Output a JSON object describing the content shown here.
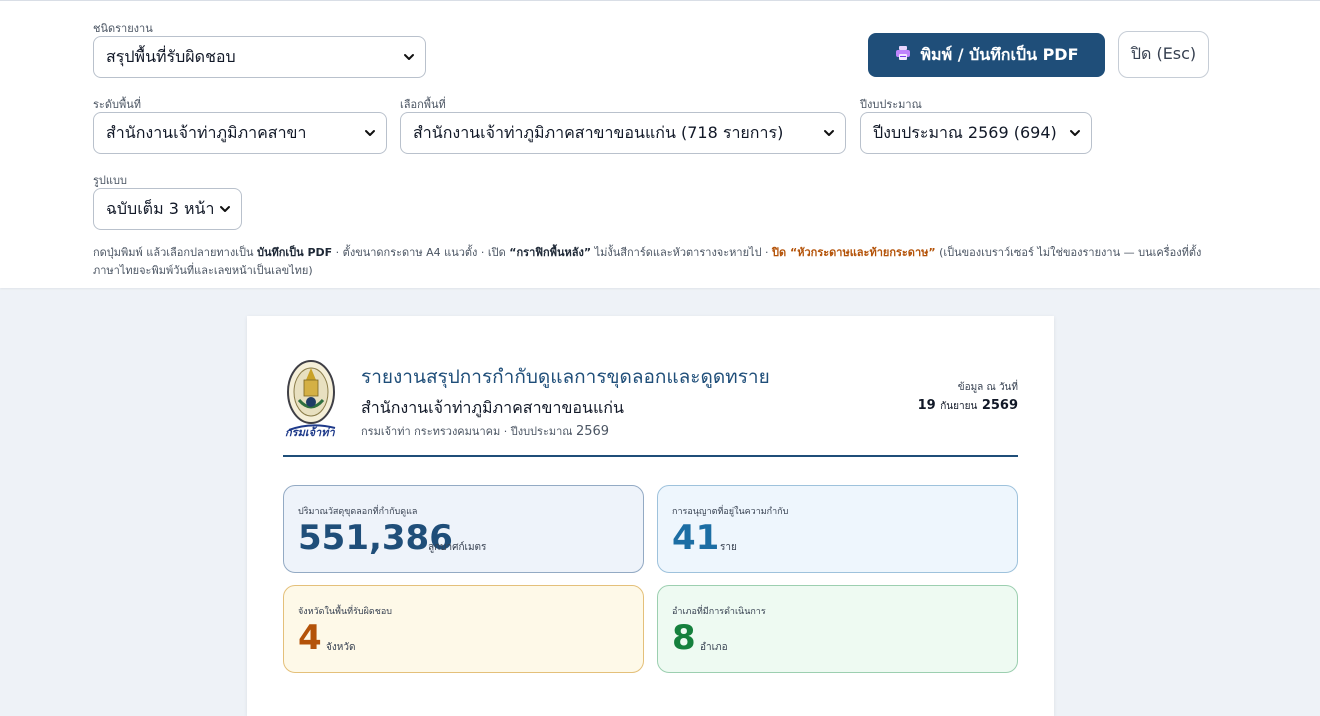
{
  "controls": {
    "report_type": {
      "label": "ชนิดรายงาน",
      "value": "สรุปพื้นที่รับผิดชอบ"
    },
    "area_level": {
      "label": "ระดับพื้นที่",
      "value": "สำนักงานเจ้าท่าภูมิภาคสาขา"
    },
    "area": {
      "label": "เลือกพื้นที่",
      "value": "สำนักงานเจ้าท่าภูมิภาคสาขาขอนแก่น (718 รายการ)"
    },
    "fiscal_year": {
      "label": "ปีงบประมาณ",
      "value": "ปีงบประมาณ 2569 (694)"
    },
    "format": {
      "label": "รูปแบบ",
      "value": "ฉบับเต็ม 3 หน้า"
    },
    "print_button": "พิมพ์ / บันทึกเป็น PDF",
    "close_button": "ปิด (Esc)"
  },
  "hint": {
    "part1": "กดปุ่มพิมพ์ แล้วเลือกปลายทางเป็น ",
    "save_pdf": "บันทึกเป็น PDF",
    "part2": " · ตั้งขนาดกระดาษ A4 แนวตั้ง · เปิด ",
    "bg_graphics": "“กราฟิกพื้นหลัง”",
    "part3": " ไม่งั้นสีการ์ดและหัวตารางจะหายไป · ",
    "close_hf": "ปิด “หัวกระดาษและท้ายกระดาษ”",
    "part4": " (เป็นของเบราว์เซอร์ ไม่ใช่ของรายงาน — บนเครื่องที่ตั้งภาษาไทยจะพิมพ์วันที่และเลขหน้าเป็นเลขไทย)"
  },
  "report": {
    "title": "รายงานสรุปการกำกับดูแลการขุดลอกและดูดทราย",
    "org": "สำนักงานเจ้าท่าภูมิภาคสาขาขอนแก่น",
    "meta_prefix": "กรมเจ้าท่า กระทรวงคมนาคม · ปีงบประมาณ ",
    "meta_year": "2569",
    "seal_text": "กรมเจ้าท่า",
    "as_of_label": "ข้อมูล ณ วันที่",
    "as_of_day": "19",
    "as_of_month": "กันยายน",
    "as_of_year": "2569"
  },
  "cards": [
    {
      "label": "ปริมาณวัสดุขุดลอกที่กำกับดูแล",
      "value": "551,386",
      "unit": "ลูกบาศก์เมตร"
    },
    {
      "label": "การอนุญาตที่อยู่ในความกำกับ",
      "value": "41",
      "unit": "ราย"
    },
    {
      "label": "จังหวัดในพื้นที่รับผิดชอบ",
      "value": "4",
      "unit": "จังหวัด"
    },
    {
      "label": "อำเภอที่มีการดำเนินการ",
      "value": "8",
      "unit": "อำเภอ"
    }
  ],
  "colors": {
    "primary": "#1f4e79",
    "accent_blue": "#1c6ea4",
    "accent_orange": "#b45309",
    "accent_green": "#15803d"
  },
  "icons": {
    "print": "printer-icon",
    "dropdown": "chevron-down-icon"
  }
}
